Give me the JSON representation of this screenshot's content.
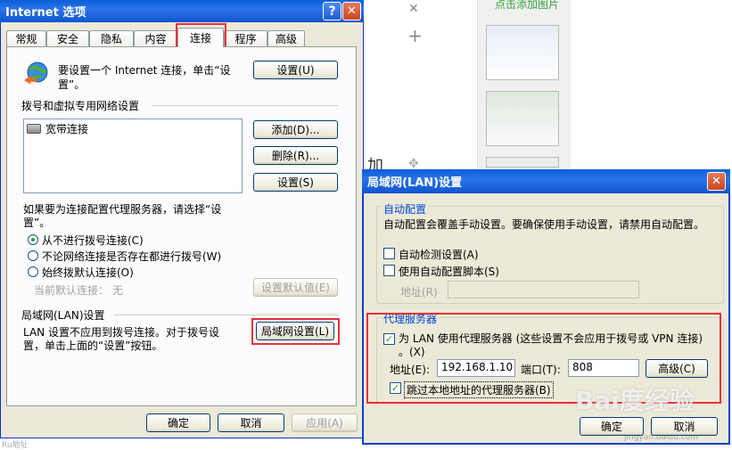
{
  "background": {
    "side_text": "点击添加图片",
    "left_char": "加",
    "watermark": "Bai度经验",
    "watermark_url": "jingyan.baidu.com",
    "bottom_left": "Ru地址"
  },
  "internet_options": {
    "title": "Internet 选项",
    "help_button": "?",
    "close_button": "✕",
    "tabs": [
      "常规",
      "安全",
      "隐私",
      "内容",
      "连接",
      "程序",
      "高级"
    ],
    "active_tab": "连接",
    "setup_text_1": "要设置一个 Internet 连接，单击“设",
    "setup_text_2": "置”。",
    "setup_button": "设置(U)",
    "dialup_group": "拨号和虚拟专用网络设置",
    "connections": [
      "宽带连接"
    ],
    "add_button": "添加(D)...",
    "remove_button": "删除(R)...",
    "settings_button": "设置(S)",
    "proxy_prompt_1": "如果要为连接配置代理服务器，请选择“设",
    "proxy_prompt_2": "置”。",
    "radio_never": "从不进行拨号连接(C)",
    "radio_whenever": "不论网络连接是否存在都进行拨号(W)",
    "radio_always": "始终拨默认连接(O)",
    "current_default_label": "当前默认连接：",
    "current_default_value": "无",
    "set_default_button": "设置默认值(E)",
    "lan_group": "局域网(LAN)设置",
    "lan_text_1": "LAN 设置不应用到拨号连接。对于拨号设",
    "lan_text_2": "置，单击上面的“设置”按钮。",
    "lan_button": "局域网设置(L)",
    "ok_button": "确定",
    "cancel_button": "取消",
    "apply_button": "应用(A)"
  },
  "lan_dialog": {
    "title": "局域网(LAN)设置",
    "close_button": "✕",
    "auto_group": "自动配置",
    "auto_desc": "自动配置会覆盖手动设置。要确保使用手动设置，请禁用自动配置。",
    "auto_detect": "自动检测设置(A)",
    "auto_script": "使用自动配置脚本(S)",
    "address_label": "地址(R)",
    "proxy_group": "代理服务器",
    "use_proxy_1": "为 LAN 使用代理服务器 (这些设置不会应用于拨号或 VPN 连接)",
    "use_proxy_2": "。(X)",
    "proxy_address_label": "地址(E):",
    "proxy_address_value": "192.168.1.10",
    "port_label": "端口(T):",
    "port_value": "808",
    "advanced_button": "高级(C)",
    "bypass_local": "跳过本地地址的代理服务器(B)",
    "ok_button": "确定",
    "cancel_button": "取消"
  }
}
